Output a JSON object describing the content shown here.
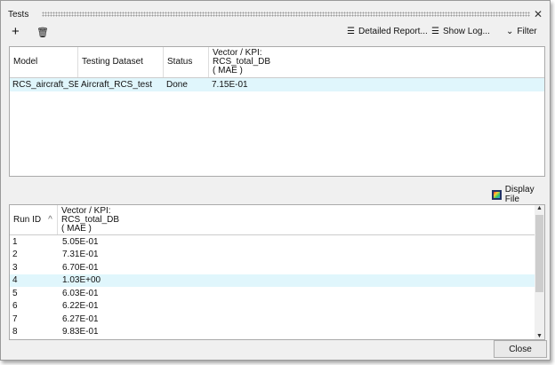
{
  "window": {
    "title": "Tests"
  },
  "toolbar": {
    "add": "+",
    "delete": "🗑",
    "detailed_report": "Detailed Report...",
    "show_log": "Show Log...",
    "filter": "Filter"
  },
  "tests_table": {
    "columns": [
      "Model",
      "Testing Dataset",
      "Status",
      "Vector / KPI:\nRCS_total_DB\n( MAE )"
    ],
    "rows": [
      [
        "RCS_aircraft_SER",
        "Aircraft_RCS_test",
        "Done",
        "7.15E-01"
      ]
    ]
  },
  "display_file": "Display File",
  "runs_table": {
    "columns": [
      "Run ID",
      "Vector / KPI:\nRCS_total_DB\n( MAE )"
    ],
    "sort_indicator": "^",
    "rows": [
      [
        "1",
        "5.05E-01"
      ],
      [
        "2",
        "7.31E-01"
      ],
      [
        "3",
        "6.70E-01"
      ],
      [
        "4",
        "1.03E+00"
      ],
      [
        "5",
        "6.03E-01"
      ],
      [
        "6",
        "6.22E-01"
      ],
      [
        "7",
        "6.27E-01"
      ],
      [
        "8",
        "9.83E-01"
      ]
    ],
    "selected_row": 3
  },
  "close_label": "Close"
}
